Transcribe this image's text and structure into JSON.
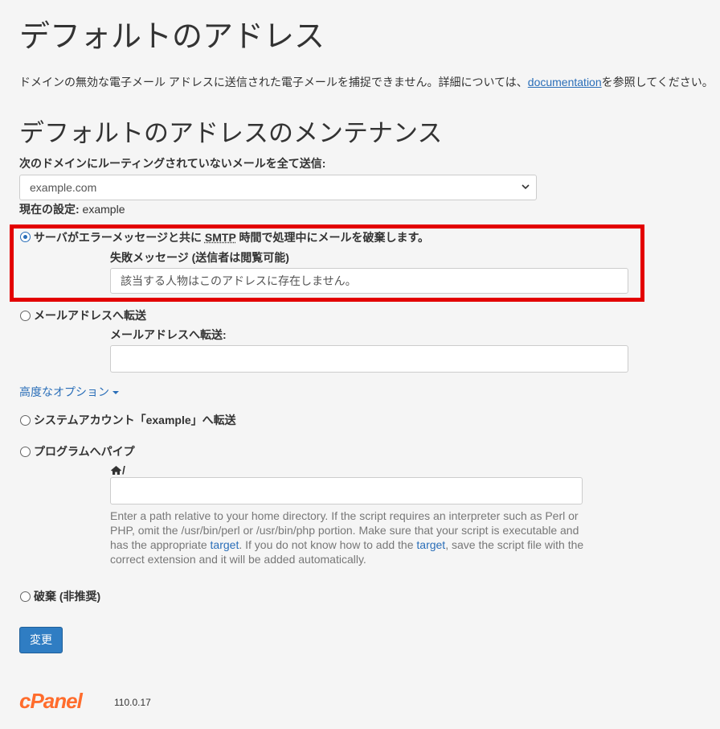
{
  "header": {
    "title": "デフォルトのアドレス",
    "description_prefix": "ドメインの無効な電子メール アドレスに送信された電子メールを捕捉できません。詳細については、",
    "description_link": "documentation",
    "description_suffix": "を参照してください。"
  },
  "maintenance": {
    "title": "デフォルトのアドレスのメンテナンス",
    "domain_label": "次のドメインにルーティングされていないメールを全て送信:",
    "domain_selected": "example.com",
    "current_label": "現在の設定:",
    "current_value": " example"
  },
  "options": {
    "fail": {
      "label_prefix": "サーバがエラーメッセージと共に ",
      "label_abbr": "SMTP",
      "label_suffix": " 時間で処理中にメールを破棄します。",
      "checked": true,
      "message_label": "失敗メッセージ (送信者は閲覧可能)",
      "message_value": "該当する人物はこのアドレスに存在しません。"
    },
    "forward": {
      "label": "メールアドレスへ転送",
      "field_label": "メールアドレスへ転送:",
      "field_value": ""
    },
    "advanced_label": "高度なオプション",
    "system_account": {
      "label": "システムアカウント「example」へ転送"
    },
    "pipe": {
      "label": "プログラムへパイプ",
      "path_prefix": "/",
      "field_value": "",
      "help_part1": "Enter a path relative to your home directory. If the script requires an interpreter such as Perl or PHP, omit the /usr/bin/perl or /usr/bin/php portion. Make sure that your script is executable and has the appropriate ",
      "help_link1": "target",
      "help_part2": ". If you do not know how to add the ",
      "help_link2": "target",
      "help_part3": ", save the script file with the correct extension and it will be added automatically."
    },
    "discard": {
      "label": "破棄 (非推奨)"
    }
  },
  "submit_label": "変更",
  "footer": {
    "logo_text": "cPanel",
    "version": "110.0.17"
  },
  "colors": {
    "accent": "#2a6eb8",
    "highlight": "#e30000",
    "logo": "#ff6c2c"
  }
}
